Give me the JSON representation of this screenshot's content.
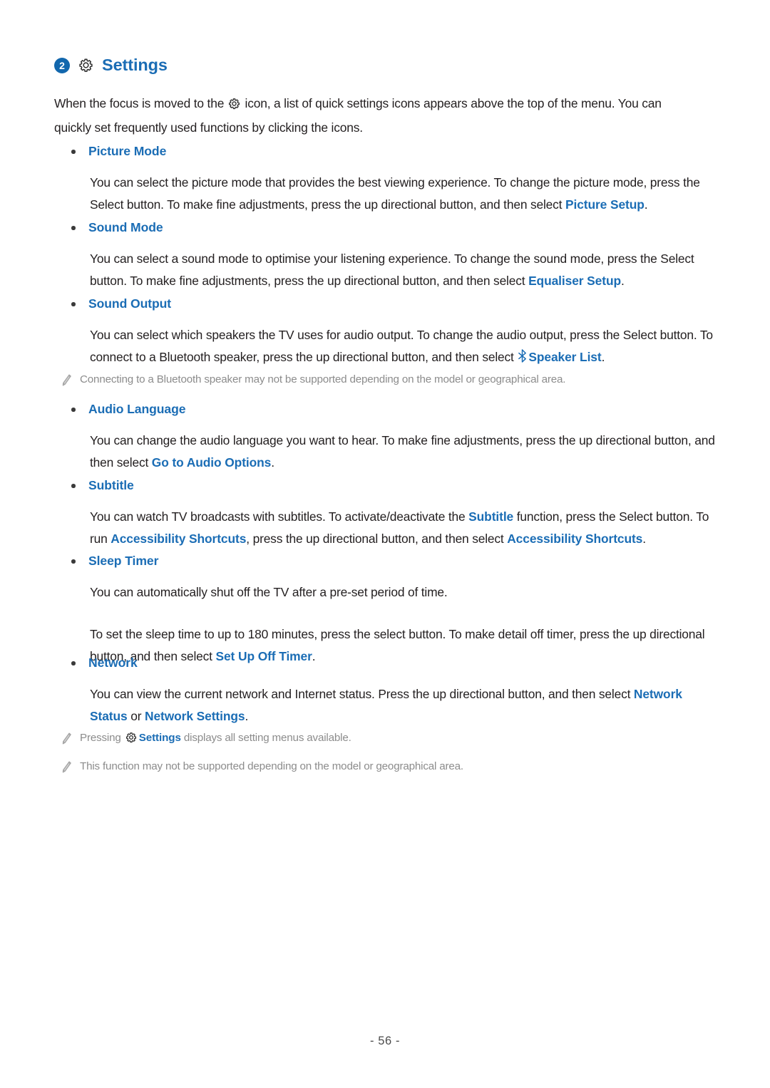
{
  "header": {
    "badge_number": "2",
    "gear_icon": "gear-icon",
    "title": "Settings",
    "accent_color": "#1b6db5",
    "badge_color": "#1267ad"
  },
  "intro": {
    "text_before_icon": "When the focus is moved to the ",
    "icon": "gear-icon",
    "text_after_icon": " icon, a list of quick settings icons appears above the top of the menu. You can quickly set frequently used functions by clicking the icons."
  },
  "sections": [
    {
      "heading": "Picture Mode",
      "paragraphs": [
        {
          "parts": [
            {
              "type": "text",
              "value": "You can select the picture mode that provides the best viewing experience. To change the picture mode, press the Select button. To make fine adjustments, press the up directional button, and then select "
            },
            {
              "type": "link",
              "value": "Picture Setup"
            },
            {
              "type": "text",
              "value": "."
            }
          ]
        }
      ]
    },
    {
      "heading": "Sound Mode",
      "paragraphs": [
        {
          "parts": [
            {
              "type": "text",
              "value": "You can select a sound mode to optimise your listening experience. To change the sound mode, press the Select button. To make fine adjustments, press the up directional button, and then select "
            },
            {
              "type": "link",
              "value": "Equaliser Setup"
            },
            {
              "type": "text",
              "value": "."
            }
          ]
        }
      ]
    },
    {
      "heading": "Sound Output",
      "paragraphs": [
        {
          "parts": [
            {
              "type": "text",
              "value": "You can select which speakers the TV uses for audio output. To change the audio output, press the Select button. To connect to a Bluetooth speaker, press the up directional button, and then select "
            },
            {
              "type": "link-icon",
              "icon": "bluetooth-icon",
              "value": "Speaker List"
            },
            {
              "type": "text",
              "value": "."
            }
          ]
        }
      ]
    },
    {
      "heading": "Audio Language",
      "paragraphs": [
        {
          "parts": [
            {
              "type": "text",
              "value": "You can change the audio language you want to hear. To make fine adjustments, press the up directional button, and then select "
            },
            {
              "type": "link",
              "value": "Go to Audio Options"
            },
            {
              "type": "text",
              "value": "."
            }
          ]
        }
      ]
    },
    {
      "heading": "Subtitle",
      "paragraphs": [
        {
          "parts": [
            {
              "type": "text",
              "value": "You can watch TV broadcasts with subtitles. To activate/deactivate the "
            },
            {
              "type": "link",
              "value": "Subtitle"
            },
            {
              "type": "text",
              "value": " function, press the Select button. To run "
            },
            {
              "type": "link",
              "value": "Accessibility Shortcuts"
            },
            {
              "type": "text",
              "value": ", press the up directional button, and then select "
            },
            {
              "type": "link",
              "value": "Accessibility Shortcuts"
            },
            {
              "type": "text",
              "value": "."
            }
          ]
        }
      ]
    },
    {
      "heading": "Sleep Timer",
      "paragraphs": [
        {
          "parts": [
            {
              "type": "text",
              "value": "You can automatically shut off the TV after a pre-set period of time."
            }
          ]
        },
        {
          "parts": [
            {
              "type": "text",
              "value": "To set the sleep time to up to 180 minutes, press the select button. To make detail off timer, press the up directional button, and then select "
            },
            {
              "type": "link",
              "value": "Set Up Off Timer"
            },
            {
              "type": "text",
              "value": "."
            }
          ]
        }
      ]
    },
    {
      "heading": "Network",
      "paragraphs": [
        {
          "parts": [
            {
              "type": "text",
              "value": "You can view the current network and Internet status. Press the up directional button, and then select "
            },
            {
              "type": "link",
              "value": "Network Status"
            },
            {
              "type": "text",
              "value": " or "
            },
            {
              "type": "link",
              "value": "Network Settings"
            },
            {
              "type": "text",
              "value": "."
            }
          ]
        }
      ]
    }
  ],
  "notes": [
    {
      "icon": "pencil-icon",
      "parts": [
        {
          "type": "text",
          "value": "Connecting to a Bluetooth speaker may not be supported depending on the model or geographical area."
        }
      ]
    },
    {
      "icon": "pencil-icon",
      "parts": [
        {
          "type": "text",
          "value": "Pressing "
        },
        {
          "type": "inline-icon",
          "icon": "gear-icon"
        },
        {
          "type": "link",
          "value": "Settings"
        },
        {
          "type": "text",
          "value": " displays all setting menus available."
        }
      ]
    },
    {
      "icon": "pencil-icon",
      "parts": [
        {
          "type": "text",
          "value": "This function may not be supported depending on the model or geographical area."
        }
      ]
    }
  ],
  "footer": {
    "page_number": "- 56 -"
  }
}
